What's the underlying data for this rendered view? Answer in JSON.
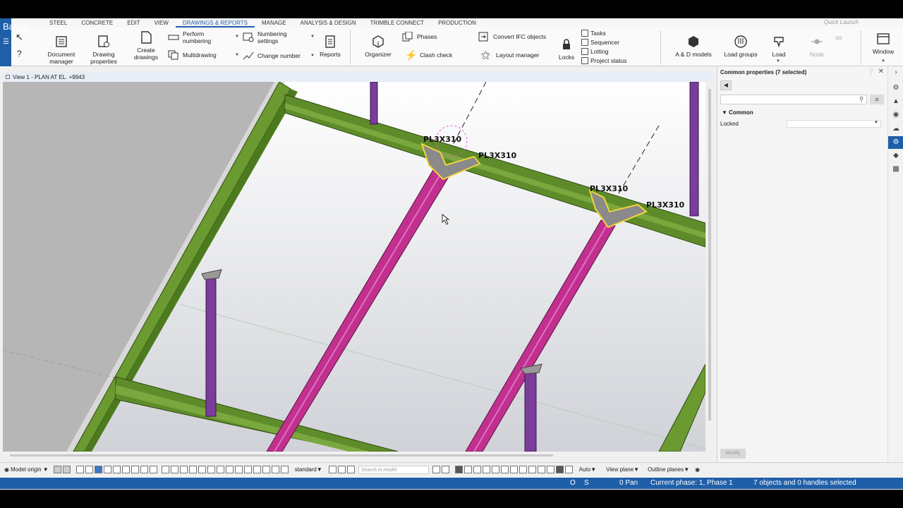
{
  "app": {
    "title": "Bats.x",
    "menu_icon": "hamburger-icon"
  },
  "ribbon_tabs": [
    "STEEL",
    "CONCRETE",
    "EDIT",
    "VIEW",
    "DRAWINGS & REPORTS",
    "MANAGE",
    "ANALYSIS & DESIGN",
    "TRIMBLE CONNECT",
    "PRODUCTION"
  ],
  "active_tab": "DRAWINGS & REPORTS",
  "quick_launch": {
    "placeholder": "Quick Launch"
  },
  "ribbon": {
    "document_manager": "Document manager",
    "drawing_properties": "Drawing properties",
    "create_drawings": "Create drawings",
    "perform_numbering": "Perform numbering",
    "multidrawing": "Multidrawing",
    "numbering_settings": "Numbering settings",
    "change_number": "Change number",
    "reports": "Reports",
    "organizer": "Organizer",
    "phases": "Phases",
    "clash_check": "Clash check",
    "convert_ifc": "Convert IFC objects",
    "layout_manager": "Layout manager",
    "locks": "Locks",
    "tasks": "Tasks",
    "sequencer": "Sequencer",
    "lotting": "Lotting",
    "project_status": "Project status",
    "ad_models": "A & D models",
    "load_groups": "Load groups",
    "load": "Load",
    "node": "Node",
    "window": "Window"
  },
  "view": {
    "title": "View 1 - PLAN AT EL. +9943",
    "labels": [
      "PL3X310",
      "PL3X310",
      "PL3X310",
      "PL3X310"
    ]
  },
  "properties": {
    "title": "Common properties (7 selected)",
    "section": "Common",
    "locked_label": "Locked",
    "locked_value": "",
    "modify_button": "Modify"
  },
  "bottom_toolbar": {
    "model_origin": "Model origin",
    "standard": "standard",
    "search_placeholder": "Search in model",
    "auto": "Auto",
    "view_plane": "View plane",
    "outline_planes": "Outline planes"
  },
  "status": {
    "o": "O",
    "s": "S",
    "pan": "0 Pan",
    "phase": "Current phase: 1, Phase 1",
    "selection": "7 objects and 0 handles selected"
  },
  "colors": {
    "accent": "#1e5fa8",
    "beam_green": "#5e8c2a",
    "beam_magenta": "#c2308f",
    "column_purple": "#7a3d9a",
    "selection_yellow": "#f2d43c"
  }
}
